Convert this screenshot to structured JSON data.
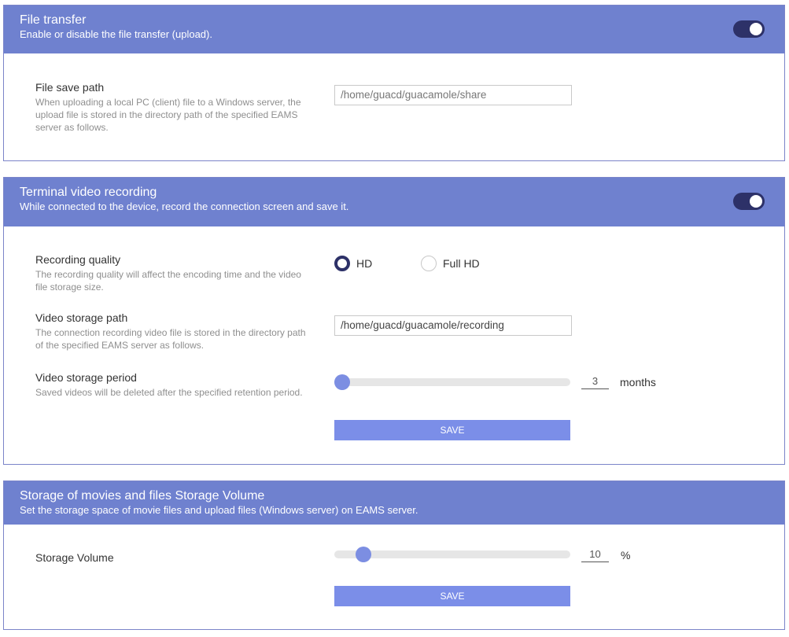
{
  "file_transfer": {
    "title": "File transfer",
    "subtitle": "Enable or disable the file transfer (upload).",
    "enabled": true,
    "save_path": {
      "label": "File save path",
      "description": "When uploading a local PC (client) file to a Windows server, the upload file is stored in the directory path of the specified EAMS server as follows.",
      "value": "/home/guacd/guacamole/share"
    }
  },
  "video_recording": {
    "title": "Terminal video recording",
    "subtitle": "While connected to the device, record the connection screen and save it.",
    "enabled": true,
    "quality": {
      "label": "Recording quality",
      "description": "The recording quality will affect the encoding time and the video file storage size.",
      "options": [
        "HD",
        "Full HD"
      ],
      "selected": "HD"
    },
    "storage_path": {
      "label": "Video storage path",
      "description": "The connection recording video file is stored in the directory path of the specified EAMS server as follows.",
      "value": "/home/guacd/guacamole/recording"
    },
    "storage_period": {
      "label": "Video storage period",
      "description": "Saved videos will be deleted after the specified retention period.",
      "value": "3",
      "unit": "months"
    },
    "save_label": "SAVE"
  },
  "storage_volume": {
    "title": "Storage of movies and files Storage Volume",
    "subtitle": "Set the storage space of movie files and upload files (Windows server) on EAMS server.",
    "label": "Storage Volume",
    "value": "10",
    "unit": "%",
    "save_label": "SAVE"
  },
  "colors": {
    "header_bg": "#6f81cf",
    "toggle_on": "#2d3168",
    "accent": "#7b8ee8"
  }
}
